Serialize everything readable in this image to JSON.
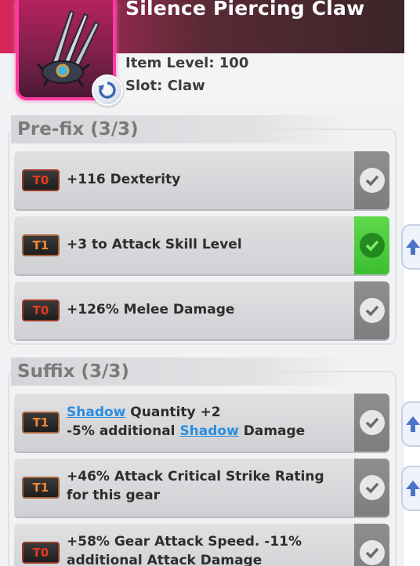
{
  "item": {
    "name": "Silence Piercing Claw",
    "level_text": "Item Level: 100",
    "slot_text": "Slot: Claw",
    "icon": "claw-weapon-icon",
    "reroll_icon": "refresh-icon"
  },
  "colors": {
    "header_accent": "#d8285a",
    "icon_border": "#ff3aa0",
    "locked_green": "#4fd03e",
    "link_blue": "#2a8ee0"
  },
  "prefix": {
    "title": "Pre-fix (3/3)",
    "rows": [
      {
        "tier": "T0",
        "text": "+116 Dexterity",
        "locked": false
      },
      {
        "tier": "T1",
        "text": "+3 to Attack Skill Level",
        "locked": true
      },
      {
        "tier": "T0",
        "text": "+126% Melee Damage",
        "locked": false
      }
    ]
  },
  "suffix": {
    "title": "Suffix (3/3)",
    "rows": [
      {
        "tier": "T1",
        "link1": "Shadow",
        "line1_rest": " Quantity +2",
        "line2_pre": "-5% additional ",
        "link2": "Shadow",
        "line2_post": " Damage",
        "locked": false
      },
      {
        "tier": "T1",
        "line1": "+46% Attack Critical Strike Rating",
        "line2": "for this gear",
        "locked": false
      },
      {
        "tier": "T0",
        "line1": "+58% Gear Attack Speed. -11%",
        "line2": "additional Attack Damage",
        "locked": false
      }
    ]
  }
}
